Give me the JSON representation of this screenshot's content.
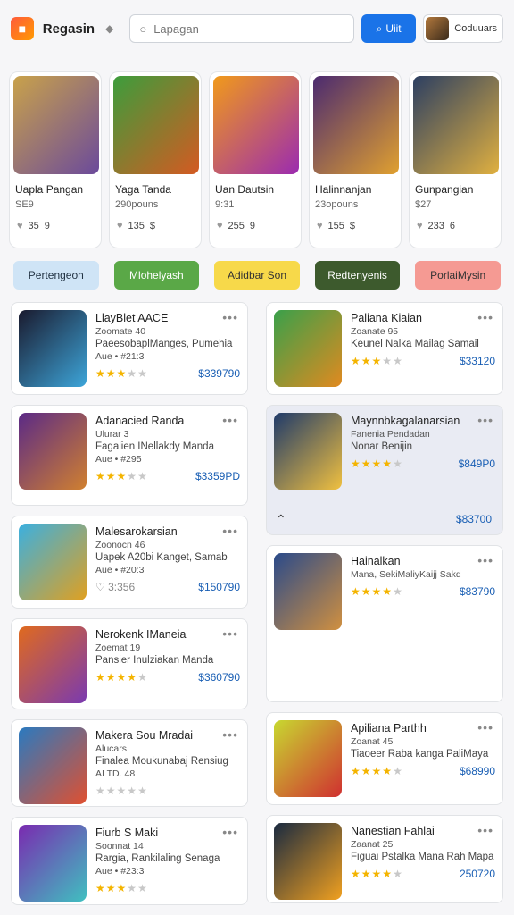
{
  "header": {
    "brand": "Regasin",
    "search_placeholder": "Lapagan",
    "search_button": "Uiit",
    "user_name": "Coduuars"
  },
  "featured": [
    {
      "title": "Uapla Pangan",
      "sub": "SE9",
      "a": "35",
      "b": "9",
      "colors": [
        "#c9a24a",
        "#6b4a9b"
      ]
    },
    {
      "title": "Yaga Tanda",
      "sub": "290pouns",
      "a": "135",
      "b": "$",
      "colors": [
        "#3c9d3c",
        "#d45a22"
      ]
    },
    {
      "title": "Uan Dautsin",
      "sub": "9:31",
      "a": "255",
      "b": "9",
      "colors": [
        "#f19a1a",
        "#9b2bb0"
      ]
    },
    {
      "title": "Halinnanjan",
      "sub": "23opouns",
      "a": "155",
      "b": "$",
      "colors": [
        "#4b2a70",
        "#e0a030"
      ]
    },
    {
      "title": "Gunpangian",
      "sub": "$27",
      "a": "233",
      "b": "6",
      "colors": [
        "#2c3f62",
        "#e0b040"
      ]
    }
  ],
  "filters": [
    {
      "label": "Pertengeon",
      "bg": "#cfe4f6",
      "fg": "#234"
    },
    {
      "label": "Mlohelyash",
      "bg": "#5aa847",
      "fg": "#fff"
    },
    {
      "label": "Adidbar Son",
      "bg": "#f7d94a",
      "fg": "#333"
    },
    {
      "label": "Redtenyenis",
      "bg": "#3d5a2d",
      "fg": "#fff"
    },
    {
      "label": "PorlaiMysin",
      "bg": "#f59a93",
      "fg": "#333"
    }
  ],
  "left_cards": [
    {
      "title": "LlayBlet AACE",
      "l1": "Zoomate 40",
      "l2": "PaeesobaplManges, Pumehia",
      "l3": "Aue • #21:3",
      "rating": 3,
      "price": "$339790",
      "colors": [
        "#1a1a2e",
        "#3da5d9"
      ]
    },
    {
      "title": "Adanacied Randa",
      "l1": "Ulurar 3",
      "l2": "Fagalien INellakdy Manda",
      "l3": "Aue • #295",
      "rating": 3,
      "price": "$3359PD",
      "colors": [
        "#5b2a86",
        "#d08030"
      ]
    },
    {
      "title": "Malesarokarsian",
      "l1": "Zoonocn 46",
      "l2": "Uapek A20bi Kanget, Samab",
      "l3": "Aue • #20:3",
      "rating": 0,
      "heart": "3:356",
      "price": "$150790",
      "colors": [
        "#3bb0e0",
        "#e0a020"
      ]
    },
    {
      "title": "Nerokenk IManeia",
      "l1": "Zoemat 19",
      "l2": "Pansier Inulziakan Manda",
      "l3": "",
      "rating": 4,
      "price": "$360790",
      "colors": [
        "#e06a1e",
        "#7a3ab0"
      ]
    },
    {
      "title": "Makera Sou Mradai",
      "l1": "Alucars",
      "l2": "Finalea Moukunabaj Rensiug",
      "l3": "AI TD. 48",
      "rating": 0,
      "price": "",
      "colors": [
        "#2a7ac0",
        "#e05030"
      ]
    },
    {
      "title": "Fiurb S Maki",
      "l1": "Soonnat 14",
      "l2": "Rargia, Rankilaling Senaga",
      "l3": "Aue • #23:3",
      "rating": 3,
      "price": "",
      "colors": [
        "#7a2ab0",
        "#40c0c0"
      ]
    }
  ],
  "right_cards": [
    {
      "title": "Paliana Kiaian",
      "l1": "Zoanate 95",
      "l2": "Keunel Nalka Mailag Samail",
      "l3": "",
      "rating": 3,
      "price": "$33120",
      "colors": [
        "#3aa04a",
        "#e08a20"
      ]
    },
    {
      "title": "Maynnbkagalanarsian",
      "l1": "Fanenia Pendadan",
      "l2": "Nonar Benijin",
      "l3": "",
      "rating": 4,
      "price": "$849P0",
      "price2": "$83700",
      "colors": [
        "#1f3a6a",
        "#f0c040"
      ]
    },
    {
      "title": "Hainalkan",
      "l1": "Mana, SekiMaliyKaijj Sakd",
      "l2": "",
      "l3": "",
      "rating": 4,
      "price": "$83790",
      "colors": [
        "#2a4a8a",
        "#d09040"
      ]
    },
    {
      "title": "Apiliana Parthh",
      "l1": "Zoanat 45",
      "l2": "Tiaoeer Raba kanga PaliMaya",
      "l3": "",
      "rating": 4,
      "price": "$68990",
      "colors": [
        "#c8d830",
        "#d03030"
      ]
    },
    {
      "title": "Nanestian Fahlai",
      "l1": "Zaanat 25",
      "l2": "Figuai Pstalka Mana Rah Mapa",
      "l3": "",
      "rating": 4,
      "price": "250720",
      "colors": [
        "#1a2a40",
        "#f0a020"
      ]
    }
  ]
}
